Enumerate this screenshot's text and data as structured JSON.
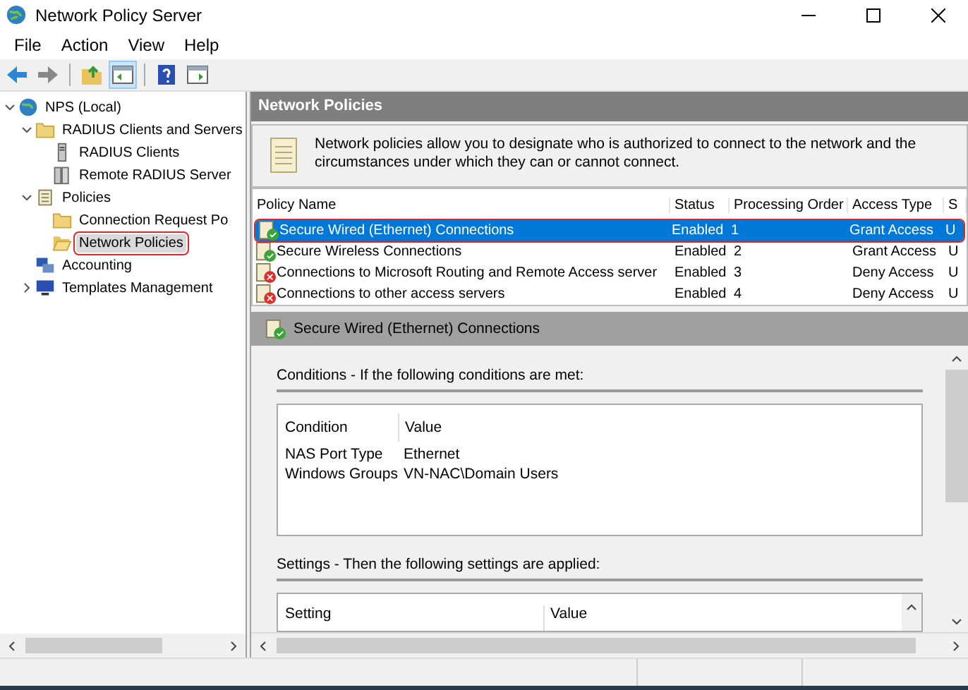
{
  "window": {
    "title": "Network Policy Server"
  },
  "menu": [
    "File",
    "Action",
    "View",
    "Help"
  ],
  "tree": [
    {
      "label": "NPS (Local)",
      "kind": "globe",
      "selected": false,
      "expanded": true,
      "children": [
        {
          "label": "RADIUS Clients and Servers",
          "kind": "folder",
          "selected": false,
          "expanded": true,
          "children": [
            {
              "label": "RADIUS Clients",
              "kind": "server",
              "selected": false
            },
            {
              "label": "Remote RADIUS Server",
              "kind": "servers",
              "selected": false
            }
          ]
        },
        {
          "label": "Policies",
          "kind": "scroll",
          "selected": false,
          "expanded": true,
          "children": [
            {
              "label": "Connection Request Po",
              "kind": "folder",
              "selected": false
            },
            {
              "label": "Network Policies",
              "kind": "folder-open",
              "selected": true
            }
          ]
        },
        {
          "label": "Accounting",
          "kind": "computers",
          "selected": false
        },
        {
          "label": "Templates Management",
          "kind": "monitor",
          "selected": false,
          "expanded": false
        }
      ]
    }
  ],
  "pane": {
    "title": "Network Policies",
    "description": "Network policies allow you to designate who is authorized to connect to the network and the circumstances under which they can or cannot connect."
  },
  "table": {
    "columns": [
      "Policy Name",
      "Status",
      "Processing Order",
      "Access Type",
      "S"
    ],
    "rows": [
      {
        "name": "Secure Wired (Ethernet) Connections",
        "status": "Enabled",
        "order": "1",
        "access": "Grant Access",
        "s": "U",
        "kind": "grant",
        "selected": true
      },
      {
        "name": "Secure Wireless Connections",
        "status": "Enabled",
        "order": "2",
        "access": "Grant Access",
        "s": "U",
        "kind": "grant",
        "selected": false
      },
      {
        "name": "Connections to Microsoft Routing and Remote Access server",
        "status": "Enabled",
        "order": "3",
        "access": "Deny Access",
        "s": "U",
        "kind": "deny",
        "selected": false
      },
      {
        "name": "Connections to other access servers",
        "status": "Enabled",
        "order": "4",
        "access": "Deny Access",
        "s": "U",
        "kind": "deny",
        "selected": false
      }
    ]
  },
  "details": {
    "title": "Secure Wired (Ethernet) Connections",
    "conditions_heading": "Conditions - If the following conditions are met:",
    "conditions_columns": [
      "Condition",
      "Value"
    ],
    "conditions": [
      {
        "condition": "NAS Port Type",
        "value": "Ethernet"
      },
      {
        "condition": "Windows Groups",
        "value": "VN-NAC\\Domain Users"
      }
    ],
    "settings_heading": "Settings - Then the following settings are applied:",
    "settings_columns": [
      "Setting",
      "Value"
    ]
  }
}
